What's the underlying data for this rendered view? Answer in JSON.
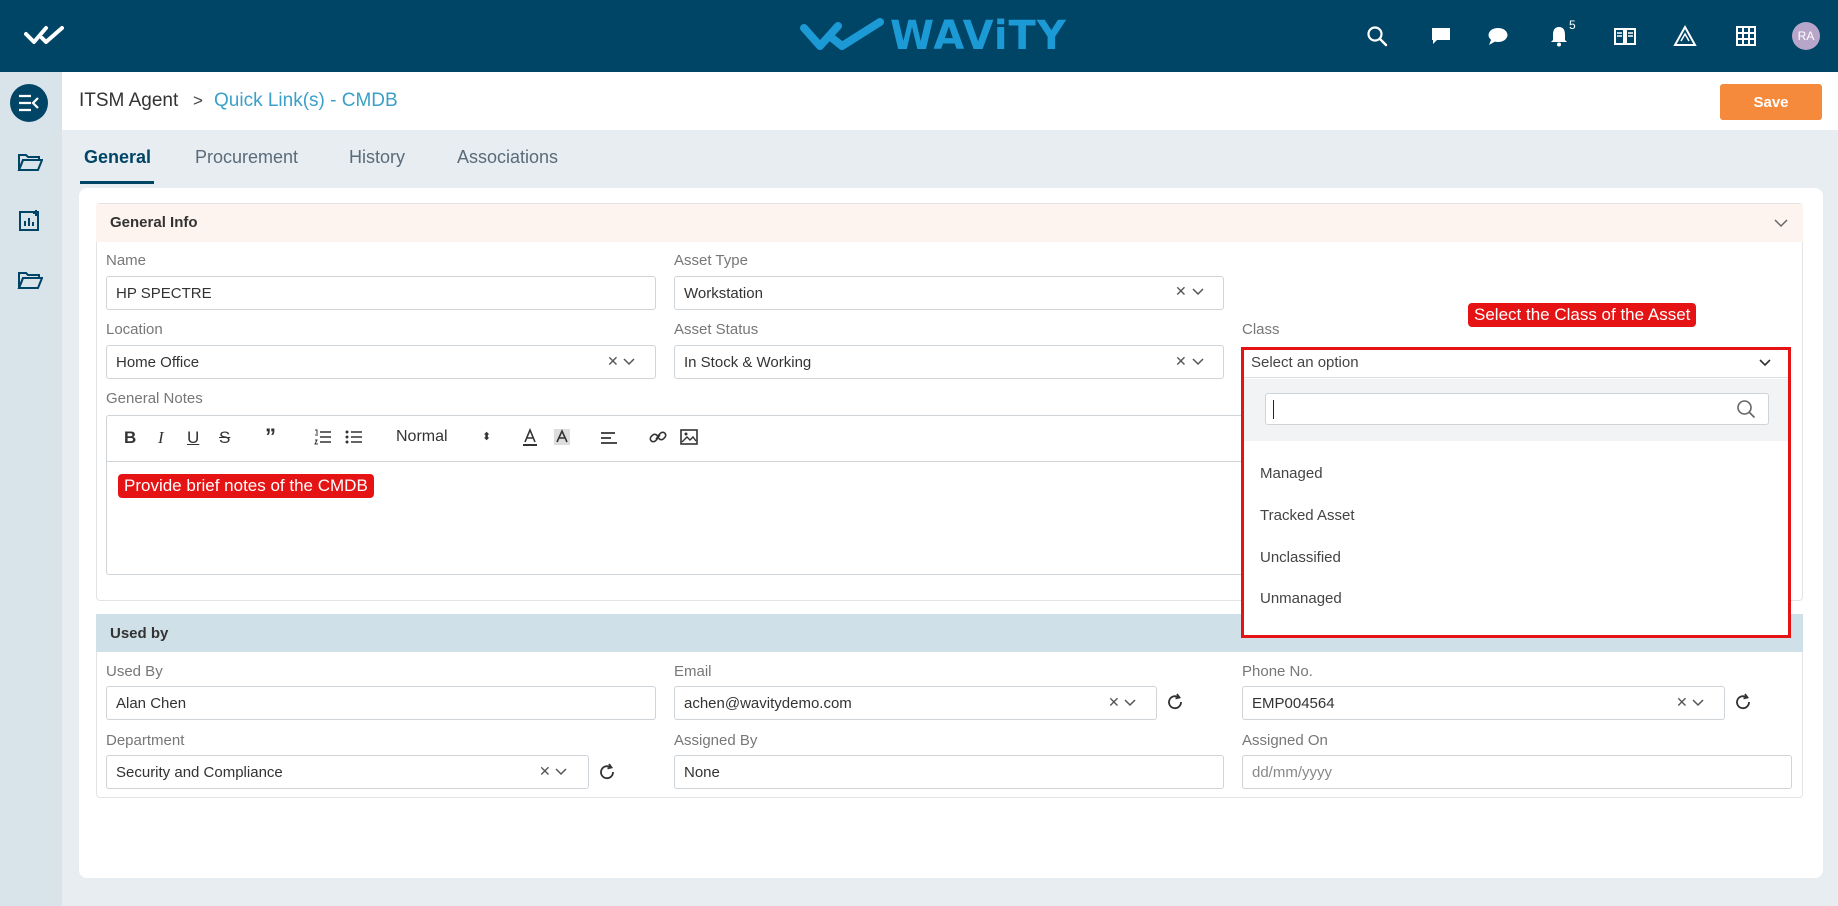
{
  "brand": {
    "name": "WAViTY"
  },
  "topbar": {
    "notification_count": "5",
    "avatar_initials": "RA"
  },
  "breadcrumb": {
    "root": "ITSM Agent",
    "separator": ">",
    "current": "Quick Link(s) - CMDB"
  },
  "actions": {
    "save_label": "Save"
  },
  "tabs": [
    {
      "label": "General",
      "active": true
    },
    {
      "label": "Procurement",
      "active": false
    },
    {
      "label": "History",
      "active": false
    },
    {
      "label": "Associations",
      "active": false
    }
  ],
  "general_info": {
    "title": "General Info",
    "name": {
      "label": "Name",
      "value": "HP SPECTRE"
    },
    "asset_type": {
      "label": "Asset Type",
      "value": "Workstation"
    },
    "location": {
      "label": "Location",
      "value": "Home Office"
    },
    "asset_status": {
      "label": "Asset Status",
      "value": "In Stock & Working"
    },
    "class": {
      "label": "Class",
      "placeholder": "Select an option",
      "options": [
        "Managed",
        "Tracked Asset",
        "Unclassified",
        "Unmanaged"
      ]
    },
    "general_notes": {
      "label": "General Notes",
      "format_select": "Normal"
    }
  },
  "used_by": {
    "title": "Used by",
    "used_by": {
      "label": "Used By",
      "value": "Alan Chen"
    },
    "email": {
      "label": "Email",
      "value": "achen@wavitydemo.com"
    },
    "phone": {
      "label": "Phone No.",
      "value": "EMP004564"
    },
    "department": {
      "label": "Department",
      "value": "Security and Compliance"
    },
    "assigned_by": {
      "label": "Assigned By",
      "value": "None"
    },
    "assigned_on": {
      "label": "Assigned On",
      "placeholder": "dd/mm/yyyy"
    }
  },
  "annotations": {
    "class_callout": "Select the Class of the Asset",
    "notes_callout": "Provide brief notes of the CMDB"
  },
  "colors": {
    "topbar": "#004466",
    "brand": "#1c9ad6",
    "save": "#f58a3c",
    "callout": "#e51313",
    "link": "#3aa0c8"
  }
}
